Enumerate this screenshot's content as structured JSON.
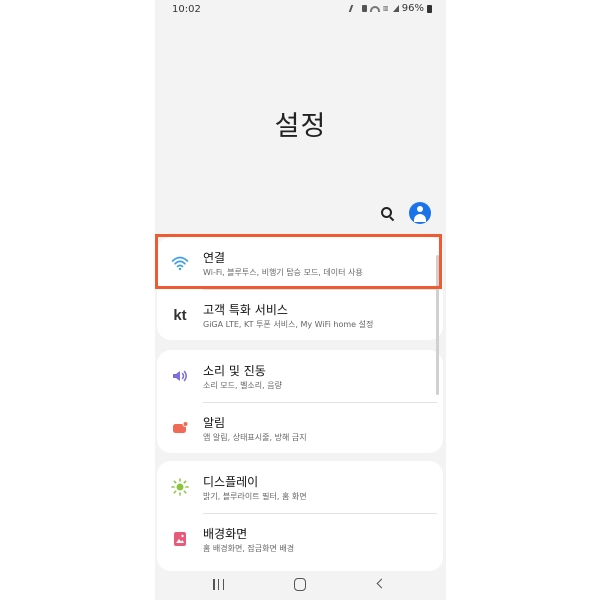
{
  "status": {
    "time": "10:02",
    "battery": "96%"
  },
  "header": {
    "title": "설정"
  },
  "settings": [
    {
      "title": "연결",
      "subtitle": "Wi-Fi, 블루투스, 비행기 탑승 모드, 데이터 사용",
      "icon": "wifi-icon"
    },
    {
      "title": "고객 특화 서비스",
      "subtitle": "GiGA LTE, KT 투폰 서비스, My WiFi home 설정",
      "icon": "kt-logo-icon",
      "icon_text": "kt"
    },
    {
      "title": "소리 및 진동",
      "subtitle": "소리 모드, 벨소리, 음량",
      "icon": "speaker-icon"
    },
    {
      "title": "알림",
      "subtitle": "앱 알림, 상태표시줄, 방해 금지",
      "icon": "notification-icon"
    },
    {
      "title": "디스플레이",
      "subtitle": "밝기, 블루라이트 필터, 홈 화면",
      "icon": "sun-icon"
    },
    {
      "title": "배경화면",
      "subtitle": "홈 배경화면, 잠금화면 배경",
      "icon": "wallpaper-icon"
    }
  ],
  "colors": {
    "highlight": "#f05a30",
    "wifi": "#3aa0e0",
    "sound": "#7b6fe0",
    "notification": "#f06a55",
    "display": "#8bc53f",
    "wallpaper": "#e85a7a",
    "profile": "#1a73e8"
  },
  "navbar": {
    "icons": [
      "recent-apps-icon",
      "home-icon",
      "back-icon"
    ]
  }
}
